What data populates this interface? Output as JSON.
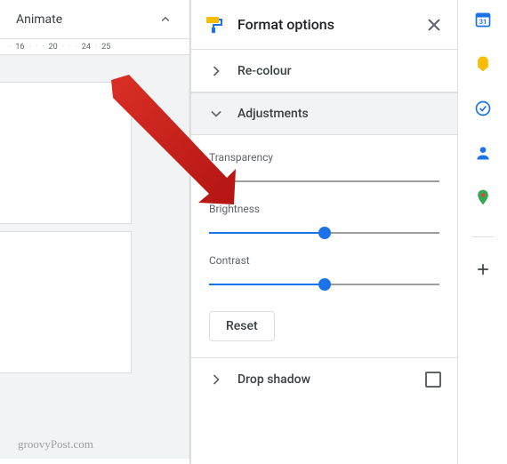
{
  "toolbar": {
    "animate_label": "Animate"
  },
  "ruler": {
    "marks": [
      "·",
      "16",
      "·",
      "·",
      "·",
      "20",
      "·",
      "·",
      "·",
      "24",
      "·",
      "25"
    ]
  },
  "panel": {
    "title": "Format options",
    "sections": {
      "recolour": {
        "label": "Re-colour"
      },
      "adjustments": {
        "label": "Adjustments",
        "sliders": [
          {
            "label": "Transparency",
            "value": 0
          },
          {
            "label": "Brightness",
            "value": 50
          },
          {
            "label": "Contrast",
            "value": 50
          }
        ],
        "reset_label": "Reset"
      },
      "drop_shadow": {
        "label": "Drop shadow"
      }
    }
  },
  "watermark": "groovyPost.com"
}
